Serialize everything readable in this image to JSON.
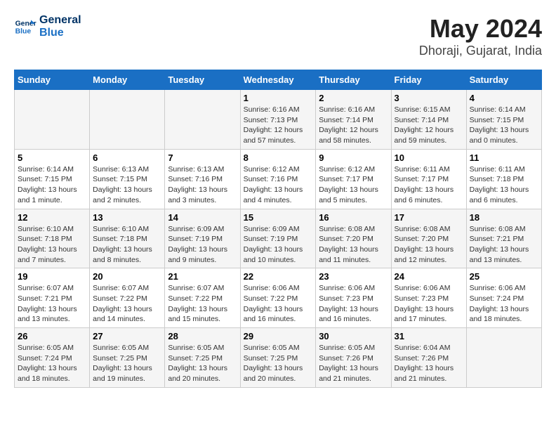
{
  "header": {
    "logo_line1": "General",
    "logo_line2": "Blue",
    "month_year": "May 2024",
    "location": "Dhoraji, Gujarat, India"
  },
  "days_of_week": [
    "Sunday",
    "Monday",
    "Tuesday",
    "Wednesday",
    "Thursday",
    "Friday",
    "Saturday"
  ],
  "weeks": [
    [
      {
        "day": "",
        "info": ""
      },
      {
        "day": "",
        "info": ""
      },
      {
        "day": "",
        "info": ""
      },
      {
        "day": "1",
        "info": "Sunrise: 6:16 AM\nSunset: 7:13 PM\nDaylight: 12 hours and 57 minutes."
      },
      {
        "day": "2",
        "info": "Sunrise: 6:16 AM\nSunset: 7:14 PM\nDaylight: 12 hours and 58 minutes."
      },
      {
        "day": "3",
        "info": "Sunrise: 6:15 AM\nSunset: 7:14 PM\nDaylight: 12 hours and 59 minutes."
      },
      {
        "day": "4",
        "info": "Sunrise: 6:14 AM\nSunset: 7:15 PM\nDaylight: 13 hours and 0 minutes."
      }
    ],
    [
      {
        "day": "5",
        "info": "Sunrise: 6:14 AM\nSunset: 7:15 PM\nDaylight: 13 hours and 1 minute."
      },
      {
        "day": "6",
        "info": "Sunrise: 6:13 AM\nSunset: 7:15 PM\nDaylight: 13 hours and 2 minutes."
      },
      {
        "day": "7",
        "info": "Sunrise: 6:13 AM\nSunset: 7:16 PM\nDaylight: 13 hours and 3 minutes."
      },
      {
        "day": "8",
        "info": "Sunrise: 6:12 AM\nSunset: 7:16 PM\nDaylight: 13 hours and 4 minutes."
      },
      {
        "day": "9",
        "info": "Sunrise: 6:12 AM\nSunset: 7:17 PM\nDaylight: 13 hours and 5 minutes."
      },
      {
        "day": "10",
        "info": "Sunrise: 6:11 AM\nSunset: 7:17 PM\nDaylight: 13 hours and 6 minutes."
      },
      {
        "day": "11",
        "info": "Sunrise: 6:11 AM\nSunset: 7:18 PM\nDaylight: 13 hours and 6 minutes."
      }
    ],
    [
      {
        "day": "12",
        "info": "Sunrise: 6:10 AM\nSunset: 7:18 PM\nDaylight: 13 hours and 7 minutes."
      },
      {
        "day": "13",
        "info": "Sunrise: 6:10 AM\nSunset: 7:18 PM\nDaylight: 13 hours and 8 minutes."
      },
      {
        "day": "14",
        "info": "Sunrise: 6:09 AM\nSunset: 7:19 PM\nDaylight: 13 hours and 9 minutes."
      },
      {
        "day": "15",
        "info": "Sunrise: 6:09 AM\nSunset: 7:19 PM\nDaylight: 13 hours and 10 minutes."
      },
      {
        "day": "16",
        "info": "Sunrise: 6:08 AM\nSunset: 7:20 PM\nDaylight: 13 hours and 11 minutes."
      },
      {
        "day": "17",
        "info": "Sunrise: 6:08 AM\nSunset: 7:20 PM\nDaylight: 13 hours and 12 minutes."
      },
      {
        "day": "18",
        "info": "Sunrise: 6:08 AM\nSunset: 7:21 PM\nDaylight: 13 hours and 13 minutes."
      }
    ],
    [
      {
        "day": "19",
        "info": "Sunrise: 6:07 AM\nSunset: 7:21 PM\nDaylight: 13 hours and 13 minutes."
      },
      {
        "day": "20",
        "info": "Sunrise: 6:07 AM\nSunset: 7:22 PM\nDaylight: 13 hours and 14 minutes."
      },
      {
        "day": "21",
        "info": "Sunrise: 6:07 AM\nSunset: 7:22 PM\nDaylight: 13 hours and 15 minutes."
      },
      {
        "day": "22",
        "info": "Sunrise: 6:06 AM\nSunset: 7:22 PM\nDaylight: 13 hours and 16 minutes."
      },
      {
        "day": "23",
        "info": "Sunrise: 6:06 AM\nSunset: 7:23 PM\nDaylight: 13 hours and 16 minutes."
      },
      {
        "day": "24",
        "info": "Sunrise: 6:06 AM\nSunset: 7:23 PM\nDaylight: 13 hours and 17 minutes."
      },
      {
        "day": "25",
        "info": "Sunrise: 6:06 AM\nSunset: 7:24 PM\nDaylight: 13 hours and 18 minutes."
      }
    ],
    [
      {
        "day": "26",
        "info": "Sunrise: 6:05 AM\nSunset: 7:24 PM\nDaylight: 13 hours and 18 minutes."
      },
      {
        "day": "27",
        "info": "Sunrise: 6:05 AM\nSunset: 7:25 PM\nDaylight: 13 hours and 19 minutes."
      },
      {
        "day": "28",
        "info": "Sunrise: 6:05 AM\nSunset: 7:25 PM\nDaylight: 13 hours and 20 minutes."
      },
      {
        "day": "29",
        "info": "Sunrise: 6:05 AM\nSunset: 7:25 PM\nDaylight: 13 hours and 20 minutes."
      },
      {
        "day": "30",
        "info": "Sunrise: 6:05 AM\nSunset: 7:26 PM\nDaylight: 13 hours and 21 minutes."
      },
      {
        "day": "31",
        "info": "Sunrise: 6:04 AM\nSunset: 7:26 PM\nDaylight: 13 hours and 21 minutes."
      },
      {
        "day": "",
        "info": ""
      }
    ]
  ]
}
